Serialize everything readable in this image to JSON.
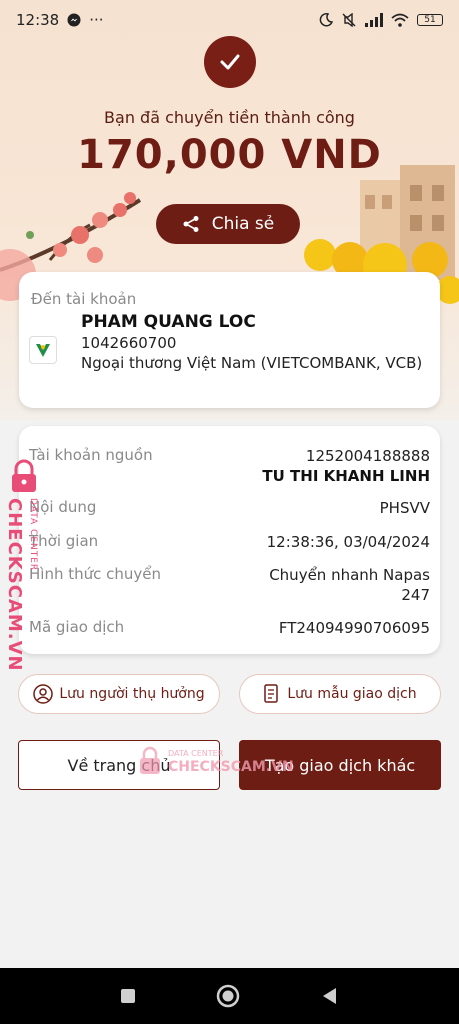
{
  "status_bar": {
    "time": "12:38",
    "more": "···",
    "battery": "51"
  },
  "header": {
    "success_message": "Bạn đã chuyển tiền thành công",
    "amount": "170,000 VND",
    "share_label": "Chia sẻ"
  },
  "recipient": {
    "heading": "Đến tài khoản",
    "name": "PHAM QUANG LOC",
    "account_number": "1042660700",
    "bank": "Ngoại thương Việt Nam (VIETCOMBANK, VCB)"
  },
  "details": {
    "source_label": "Tài khoản nguồn",
    "source_account": "1252004188888",
    "source_name": "TU THI KHANH LINH",
    "content_label": "Nội dung",
    "content_value": "PHSVV",
    "time_label": "Thời gian",
    "time_value": "12:38:36, 03/04/2024",
    "method_label": "Hình thức chuyển",
    "method_value": "Chuyển nhanh Napas 247",
    "txn_label": "Mã giao dịch",
    "txn_value": "FT24094990706095"
  },
  "actions": {
    "save_beneficiary": "Lưu người thụ hưởng",
    "save_template": "Lưu mẫu giao dịch",
    "home": "Về trang chủ",
    "new_transaction": "Tạo giao dịch khác"
  },
  "watermark": {
    "brand": "CHECKSCAM.VN",
    "sub": "DATA CENTER",
    "brand_short": "CHECKSCAM.VN",
    "sub_short": "DATA CENTER"
  },
  "colors": {
    "primary": "#6e1d14",
    "accent_watermark": "#e84d78"
  }
}
